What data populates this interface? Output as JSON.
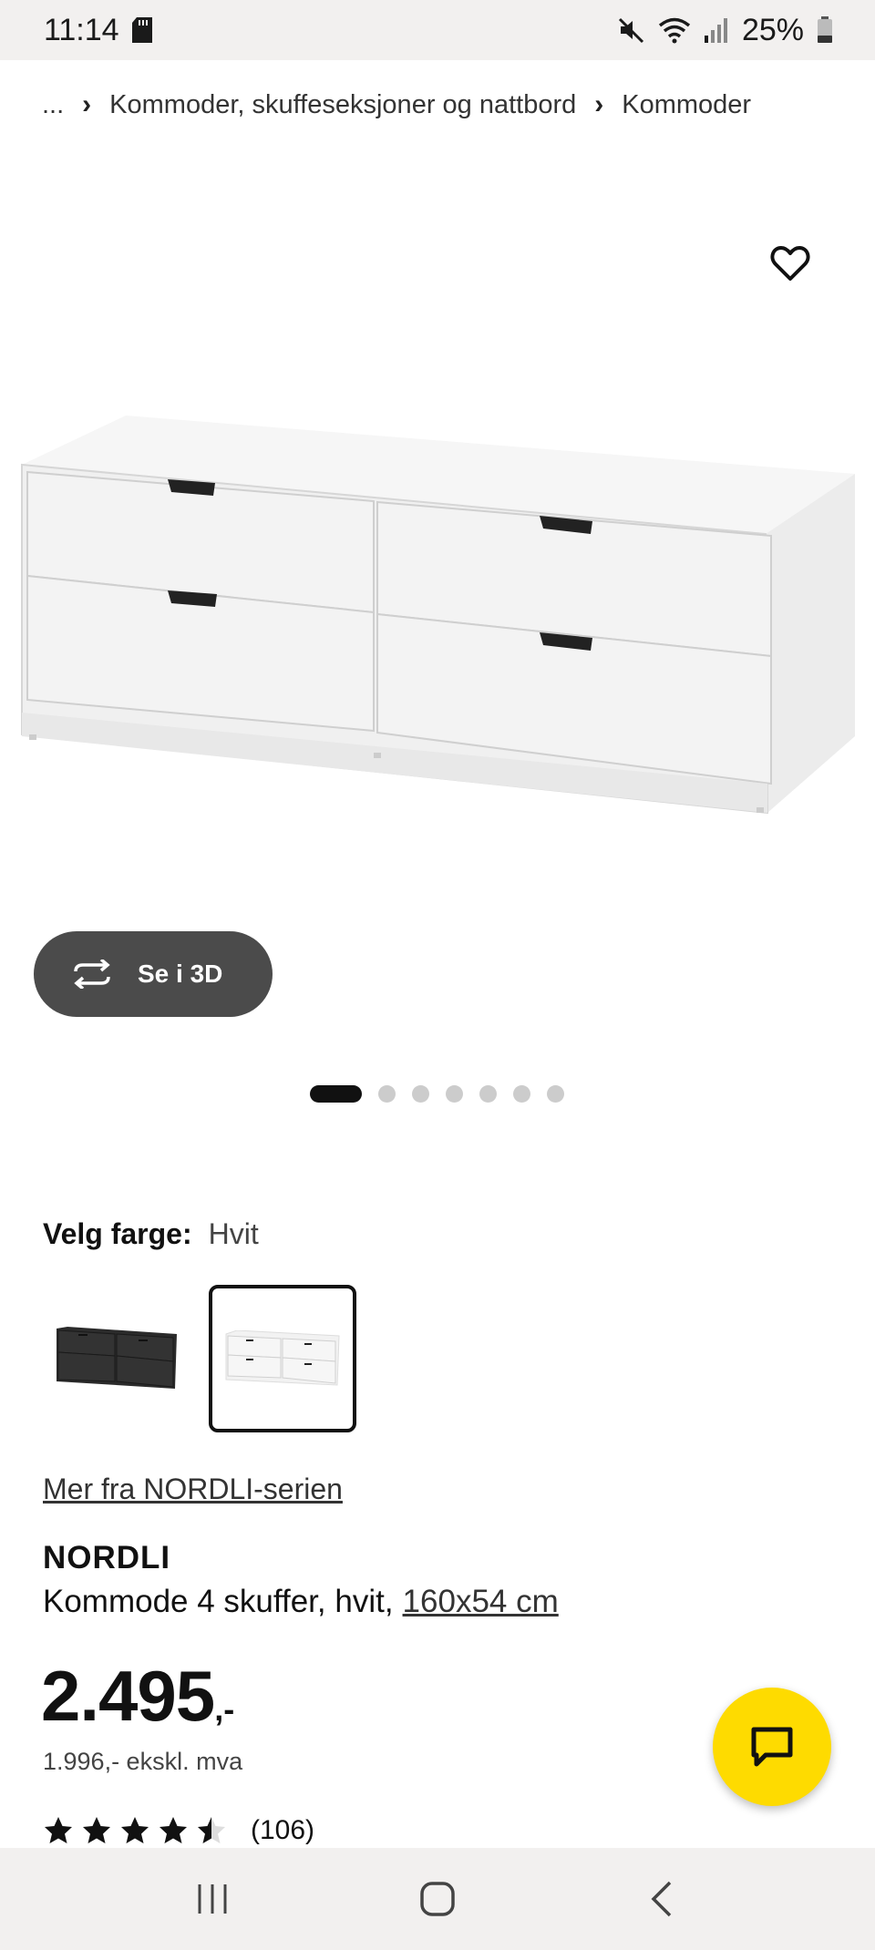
{
  "status_bar": {
    "time": "11:14",
    "battery": "25%",
    "icons": [
      "sd-card-icon",
      "mute-icon",
      "wifi-icon",
      "signal-icon",
      "battery-icon"
    ]
  },
  "breadcrumb": {
    "ellipsis": "...",
    "items": [
      "Kommoder, skuffeseksjoner og nattbord",
      "Kommoder"
    ]
  },
  "gallery": {
    "favourite_icon": "heart-outline-icon",
    "view_3d_label": "Se i 3D",
    "view_3d_icon": "rotate-3d-icon",
    "image_count": 7,
    "active_index": 0
  },
  "color_picker": {
    "label": "Velg farge:",
    "selected_value": "Hvit",
    "options": [
      {
        "name": "black-swatch",
        "color": "#2a2a2a"
      },
      {
        "name": "white-swatch",
        "color": "#ffffff",
        "selected": true
      }
    ]
  },
  "product": {
    "series_link": "Mer fra NORDLI-serien",
    "name": "NORDLI",
    "description": "Kommode 4 skuffer, hvit,",
    "size_link": "160x54 cm",
    "price_main": "2.495",
    "price_suffix": ",-",
    "price_ex_vat": "1.996,- ekskl. mva",
    "rating": 4.5,
    "review_count": "(106)"
  },
  "chat": {
    "icon": "chat-bubble-icon",
    "color": "#fedb00"
  },
  "nav_bar": {
    "icons": [
      "recent-apps-icon",
      "home-icon",
      "back-icon"
    ]
  }
}
